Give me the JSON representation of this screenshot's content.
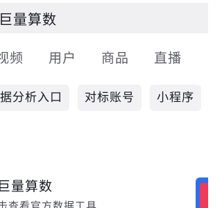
{
  "search": {
    "query": "巨量算数"
  },
  "tabs": [
    {
      "label": "视频"
    },
    {
      "label": "用户"
    },
    {
      "label": "商品"
    },
    {
      "label": "直播"
    }
  ],
  "chips": [
    {
      "label": "据分析入口"
    },
    {
      "label": "对标账号"
    },
    {
      "label": "小程序"
    }
  ],
  "result": {
    "title": "巨量算数",
    "description": "击查看官方数据工具",
    "icon": "app-logo-icon"
  },
  "colors": {
    "search_bg": "#f0f0f3",
    "chip_bg": "#f2f2f4",
    "tab_text": "#5c5d66",
    "icon_blue": "#2f6fe8",
    "icon_red": "#ef3b5a"
  }
}
